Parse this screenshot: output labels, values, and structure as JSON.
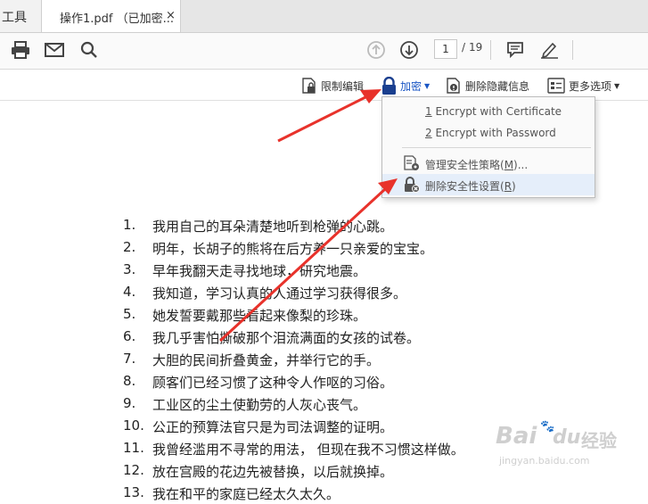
{
  "tabs": {
    "tools_label": "工具",
    "doc_title": "操作1.pdf （已加密...",
    "close_symbol": "×"
  },
  "toolbar": {
    "current_page": "1",
    "page_separator": "/",
    "total_pages": "19",
    "icons": [
      "print-icon",
      "email-icon",
      "search-icon",
      "page-up-icon",
      "page-down-icon",
      "comment-icon",
      "sign-icon"
    ]
  },
  "protect_bar": {
    "restrict_edit": "限制编辑",
    "encrypt": "加密",
    "remove_hidden": "删除隐藏信息",
    "more_options": "更多选项"
  },
  "encrypt_menu": {
    "items": [
      {
        "num": "1",
        "label": "Encrypt with Certificate"
      },
      {
        "num": "2",
        "label": "Encrypt with Password"
      },
      {
        "label": "管理安全性策略(",
        "mnemonic": "M",
        "suffix": ")..."
      },
      {
        "label": "删除安全性设置(",
        "mnemonic": "R",
        "suffix": ")"
      }
    ]
  },
  "document": {
    "lines": [
      {
        "n": "1.",
        "t": "我用自己的耳朵清楚地听到枪弹的心跳。"
      },
      {
        "n": "2.",
        "t": "明年，长胡子的熊将在后方养一只亲爱的宝宝。"
      },
      {
        "n": "3.",
        "t": "早年我翻天走寻找地球，研究地震。"
      },
      {
        "n": "4.",
        "t": "我知道，学习认真的人通过学习获得很多。"
      },
      {
        "n": "5.",
        "t": "她发誓要戴那些看起来像梨的珍珠。"
      },
      {
        "n": "6.",
        "t": "我几乎害怕撕破那个泪流满面的女孩的试卷。"
      },
      {
        "n": "7.",
        "t": "大胆的民间折叠黄金，并举行它的手。"
      },
      {
        "n": "8.",
        "t": "顾客们已经习惯了这种令人作呕的习俗。"
      },
      {
        "n": "9.",
        "t": "工业区的尘土使勤劳的人灰心丧气。"
      },
      {
        "n": "10.",
        "t": "公正的预算法官只是为司法调整的证明。"
      },
      {
        "n": "11.",
        "t": "我曾经滥用不寻常的用法，  但现在我不习惯这样做。"
      },
      {
        "n": "12.",
        "t": "放在宫殿的花边先被替换，以后就换掉。"
      },
      {
        "n": "13.",
        "t": "我在和平的家庭已经太久太久。"
      }
    ]
  },
  "watermark": {
    "brand": "Bai",
    "paw": "du",
    "cn": "经验",
    "url": "jingyan.baidu.com"
  },
  "colors": {
    "arrow": "#e8322b",
    "accent": "#1a56c4",
    "menu_highlight": "#e5eefa"
  }
}
